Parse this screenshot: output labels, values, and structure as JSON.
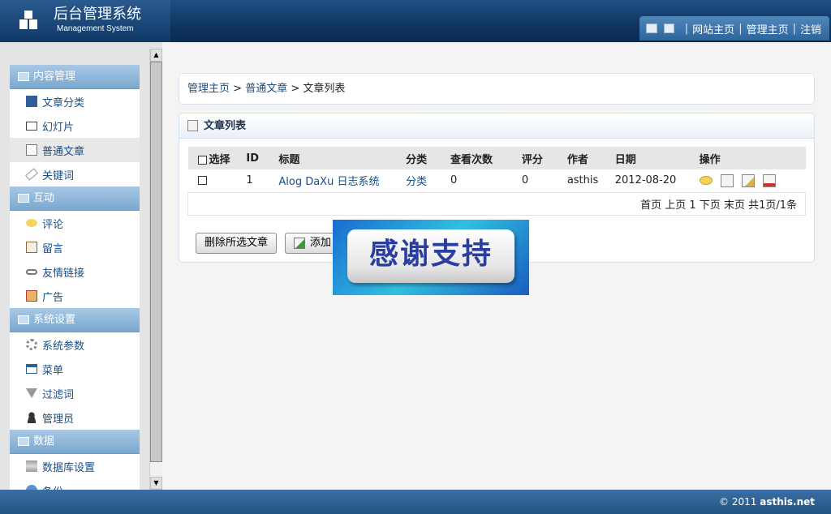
{
  "header": {
    "title": "后台管理系统",
    "subtitle": "Management System",
    "nav": [
      {
        "label": "网站主页"
      },
      {
        "label": "管理主页"
      },
      {
        "label": "注销"
      }
    ]
  },
  "sidebar": {
    "groups": [
      {
        "label": "内容管理",
        "items": [
          {
            "label": "文章分类",
            "icon": "book-icon"
          },
          {
            "label": "幻灯片",
            "icon": "monitor-icon"
          },
          {
            "label": "普通文章",
            "icon": "document-icon"
          },
          {
            "label": "关键词",
            "icon": "tag-icon"
          }
        ]
      },
      {
        "label": "互动",
        "items": [
          {
            "label": "评论",
            "icon": "comment-icon"
          },
          {
            "label": "留言",
            "icon": "clipboard-icon"
          },
          {
            "label": "友情链接",
            "icon": "link-icon"
          },
          {
            "label": "广告",
            "icon": "ad-icon"
          }
        ]
      },
      {
        "label": "系统设置",
        "items": [
          {
            "label": "系统参数",
            "icon": "gear-icon"
          },
          {
            "label": "菜单",
            "icon": "menu-icon"
          },
          {
            "label": "过滤词",
            "icon": "filter-icon"
          },
          {
            "label": "管理员",
            "icon": "user-icon"
          }
        ]
      },
      {
        "label": "数据",
        "items": [
          {
            "label": "数据库设置",
            "icon": "database-icon"
          },
          {
            "label": "备份",
            "icon": "backup-icon"
          }
        ]
      }
    ]
  },
  "breadcrumb": {
    "home": "管理主页",
    "sep1": ">",
    "parent": "普通文章",
    "sep2": ">",
    "current": "文章列表"
  },
  "panel": {
    "title": "文章列表"
  },
  "table": {
    "headers": {
      "select": "选择",
      "id": "ID",
      "title": "标题",
      "category": "分类",
      "views": "查看次数",
      "rating": "评分",
      "author": "作者",
      "date": "日期",
      "actions": "操作"
    },
    "rows": [
      {
        "id": "1",
        "title": "Alog DaXu 日志系统",
        "category": "分类",
        "views": "0",
        "rating": "0",
        "author": "asthis",
        "date": "2012-08-20"
      }
    ],
    "pager": "首页 上页 1 下页 末页 共1页/1条"
  },
  "buttons": {
    "delete_selected": "删除所选文章",
    "add": "添加"
  },
  "overlay": {
    "text": "感谢支持"
  },
  "footer": {
    "copyright": "© 2011",
    "site": "asthis.net"
  },
  "colors": {
    "header_bg": "#0f3560",
    "link": "#1a4e85",
    "sidebar_group": "#7aa8d0",
    "footer_bg": "#235582"
  }
}
